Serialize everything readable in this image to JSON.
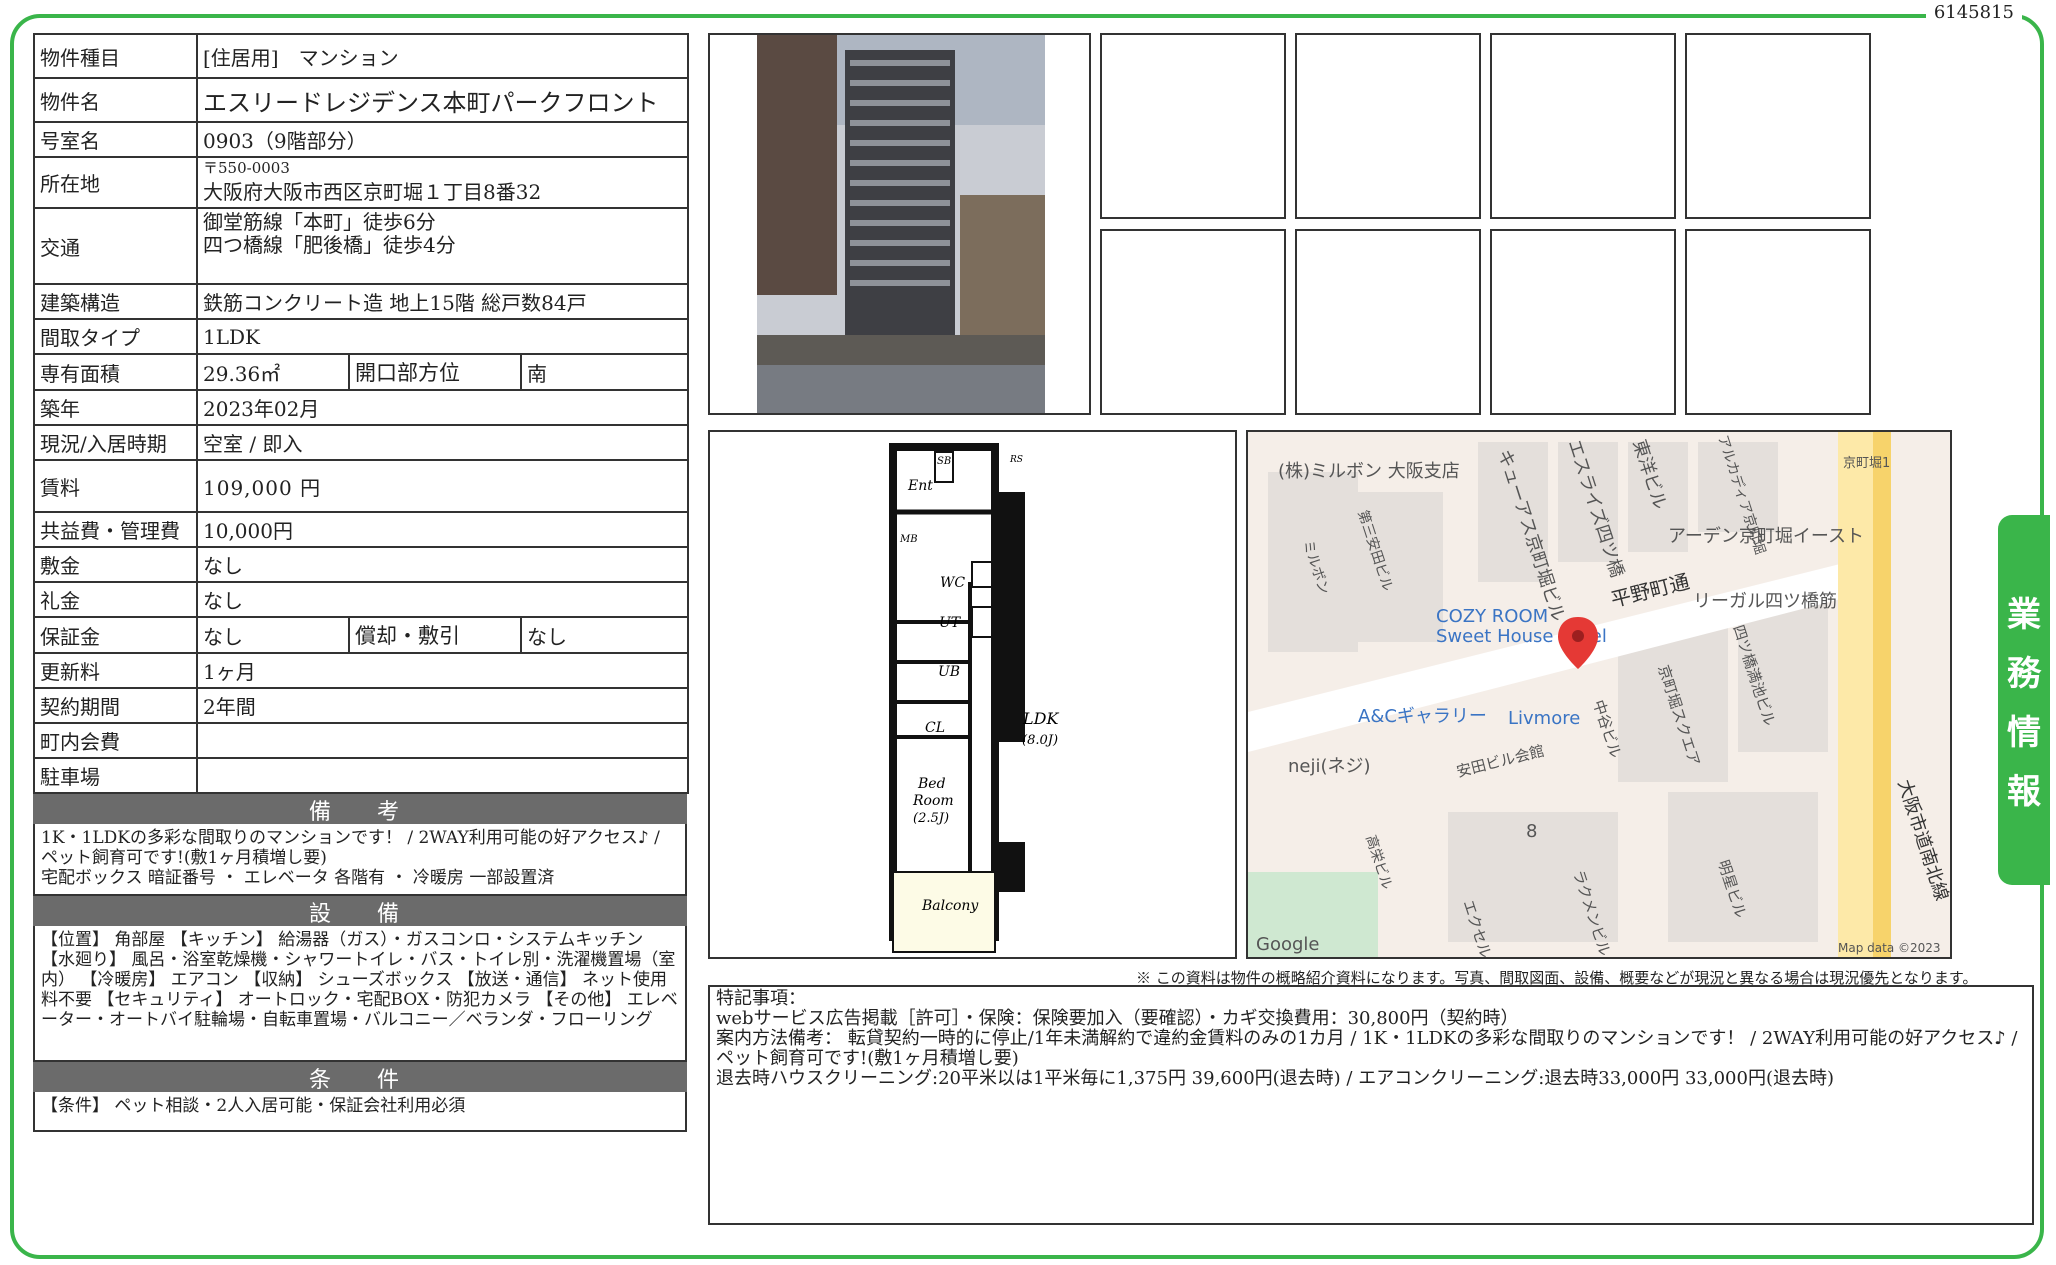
{
  "doc_id": "6145815",
  "side_tab": [
    "業",
    "務",
    "情",
    "報"
  ],
  "rows": {
    "type": {
      "label": "物件種目",
      "value": "[住居用]　マンション"
    },
    "name": {
      "label": "物件名",
      "value": "エスリードレジデンス本町パークフロント"
    },
    "room": {
      "label": "号室名",
      "value": "0903（9階部分）"
    },
    "address": {
      "label": "所在地",
      "postal": "〒550-0003",
      "value": "大阪府大阪市西区京町堀１丁目8番32"
    },
    "transport": {
      "label": "交通",
      "line1": "御堂筋線「本町」徒歩6分",
      "line2": "四つ橋線「肥後橋」徒歩4分"
    },
    "structure": {
      "label": "建築構造",
      "value": "鉄筋コンクリート造 地上15階 総戸数84戸"
    },
    "layout": {
      "label": "間取タイプ",
      "value": "1LDK"
    },
    "area": {
      "label": "専有面積",
      "value": "29.36㎡",
      "sub_label": "開口部方位",
      "sub_value": "南"
    },
    "built": {
      "label": "築年",
      "value": "2023年02月"
    },
    "status": {
      "label": "現況/入居時期",
      "value": "空室 / 即入"
    },
    "rent": {
      "label": "賃料",
      "value": "109,000 円"
    },
    "fee": {
      "label": "共益費・管理費",
      "value": "10,000円"
    },
    "deposit": {
      "label": "敷金",
      "value": "なし"
    },
    "key_money": {
      "label": "礼金",
      "value": "なし"
    },
    "guarantee": {
      "label": "保証金",
      "value": "なし",
      "sub_label": "償却・敷引",
      "sub_value": "なし"
    },
    "renewal": {
      "label": "更新料",
      "value": "1ヶ月"
    },
    "contract": {
      "label": "契約期間",
      "value": "2年間"
    },
    "community": {
      "label": "町内会費",
      "value": ""
    },
    "parking": {
      "label": "駐車場",
      "value": ""
    }
  },
  "biko": {
    "title": "備　考",
    "line1": "1K・1LDKの多彩な間取りのマンションです！ / 2WAY利用可能の好アクセス♪ / ペット飼育可です!(敷1ヶ月積増し要)",
    "line2": "宅配ボックス 暗証番号 ・ エレベータ 各階有 ・ 冷暖房 一部設置済"
  },
  "setsubi": {
    "title": "設　備",
    "text": "【位置】 角部屋 【キッチン】 給湯器（ガス）・ガスコンロ・システムキッチン 【水廻り】 風呂・浴室乾燥機・シャワートイレ・バス・トイレ別・洗濯機置場（室内） 【冷暖房】 エアコン 【収納】 シューズボックス 【放送・通信】 ネット使用料不要 【セキュリティ】 オートロック・宅配BOX・防犯カメラ 【その他】 エレベーター・オートバイ駐輪場・自転車置場・バルコニー／ベランダ・フローリング"
  },
  "joken": {
    "title": "条　件",
    "text": "【条件】 ペット相談・2人入居可能・保証会社利用必須"
  },
  "floorplan": {
    "labels": [
      "Ent",
      "SB",
      "MB",
      "WC",
      "UT",
      "UB",
      "CL",
      "LDK",
      "(8.0J)",
      "Bed",
      "Room",
      "(2.5J)",
      "Balcony",
      "RS"
    ]
  },
  "map": {
    "labels": [
      "(株)ミルボン 大阪支店",
      "キューアス京町堀ビル",
      "エスライズ四ツ橋",
      "東洋ビル",
      "アルカディア京町堀",
      "京町堀1",
      "アーデン京町堀イースト",
      "平野町通",
      "リーガル四ツ橋筋",
      "COZY ROOM",
      "Sweet House Hotel",
      "四ツ橋満池ビル",
      "京町堀スクエア",
      "A&Cギャラリー",
      "Livmore",
      "中谷ビル",
      "neji(ネジ)",
      "安田ビル会館",
      "8",
      "高栄ビル",
      "ラクメンビル",
      "明星ビル",
      "エクセル",
      "大阪市道南北線",
      "第三安田ビル",
      "ミルボン",
      "Google",
      "Map data ©2023"
    ]
  },
  "notice": "※ この資料は物件の概略紹介資料になります。写真、間取図面、設備、概要などが現況と異なる場合は現況優先となります。",
  "remarks": {
    "line1": "特記事項：",
    "line2": "webサービス広告掲載［許可］・保険：保険要加入（要確認）・カギ交換費用：30,800円（契約時）",
    "line3": "案内方法備考： 転貸契約一時的に停止/1年未満解約で違約金賃料のみの1カ月 / 1K・1LDKの多彩な間取りのマンションです！ / 2WAY利用可能の好アクセス♪ / ペット飼育可です!(敷1ヶ月積増し要)",
    "line4": "退去時ハウスクリーニング:20平米以は1平米毎に1,375円 39,600円(退去時) / エアコンクリーニング:退去時33,000円 33,000円(退去時)"
  }
}
